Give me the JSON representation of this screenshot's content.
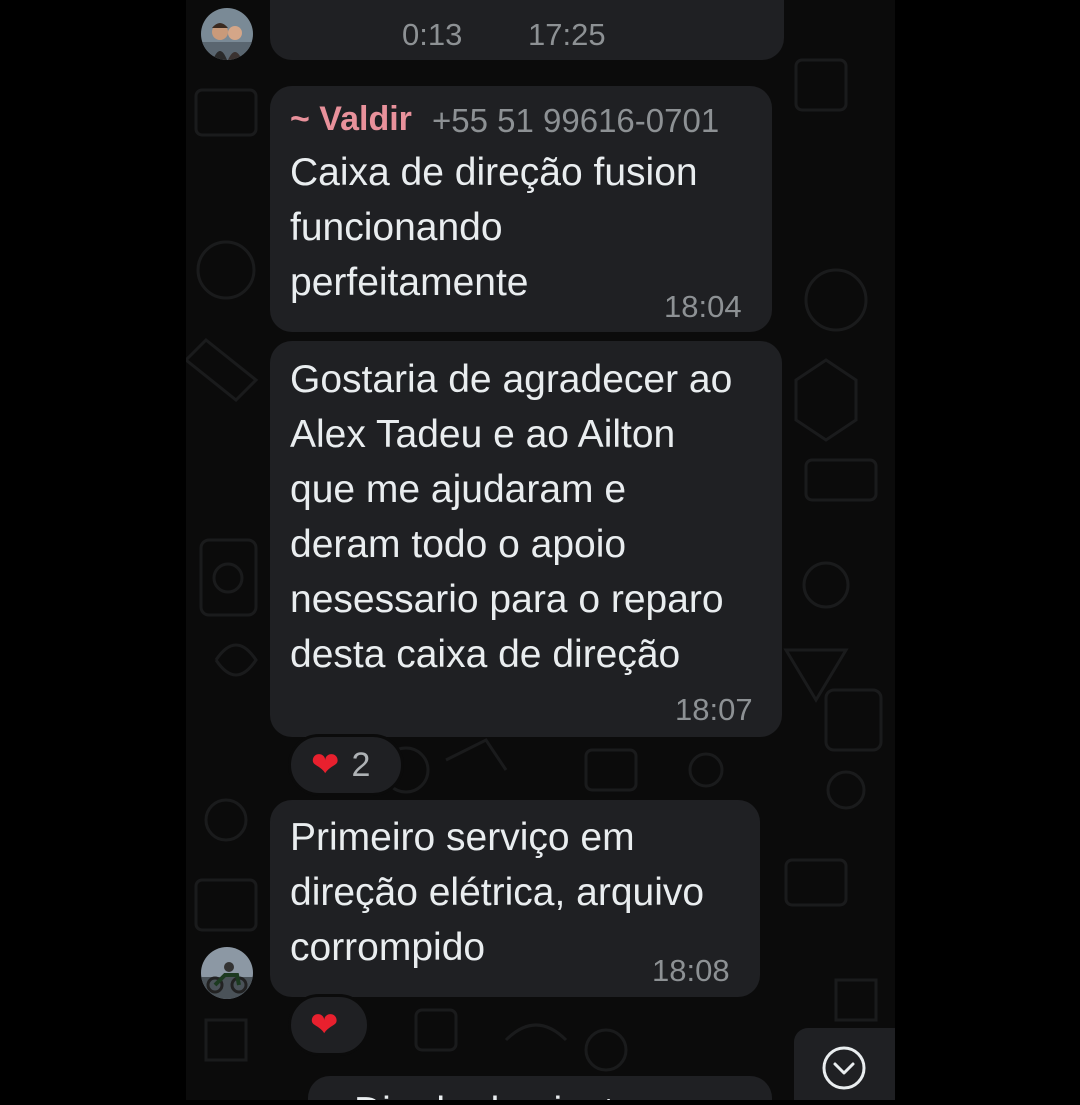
{
  "colors": {
    "bubble": "#1f2023",
    "chat_background": "#0b0b0b",
    "sender_name": "#e8919b",
    "timestamp": "#8d9194",
    "heart": "#e8202e"
  },
  "audio_message": {
    "duration": "0:13",
    "time": "17:25"
  },
  "messages": [
    {
      "sender_name": "~ Valdir",
      "sender_phone": "+55 51 99616-0701",
      "text": "Caixa de direção fusion\nfuncionando\nperfeitamente",
      "time": "18:04"
    },
    {
      "text": "Gostaria de agradecer ao\nAlex Tadeu e ao Ailton\nque me ajudaram e\nderam todo o apoio\nnesessario para o reparo\ndesta caixa de direção",
      "time": "18:07",
      "reaction": {
        "icon": "heart-icon",
        "count": "2"
      }
    },
    {
      "text": "Primeiro serviço em\ndireção elétrica, arquivo\ncorrompido",
      "time": "18:08",
      "reaction": {
        "icon": "heart-icon"
      }
    }
  ],
  "partial_message": {
    "text": "Dia de de ajuste"
  },
  "scroll_button": {
    "icon": "chevron-down-icon"
  }
}
